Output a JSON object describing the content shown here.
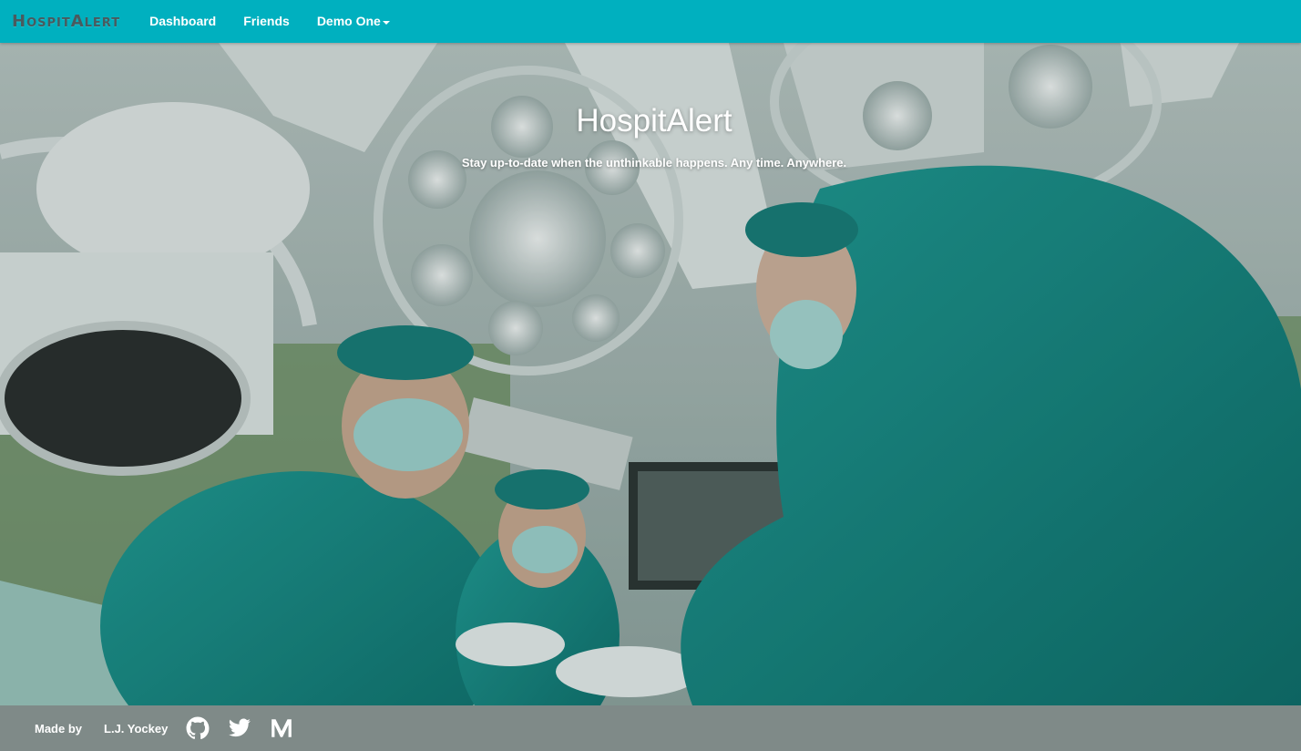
{
  "navbar": {
    "brand": "HospitAlert",
    "items": [
      {
        "label": "Dashboard"
      },
      {
        "label": "Friends"
      },
      {
        "label": "Demo One"
      }
    ],
    "color": "#00b0bf"
  },
  "hero": {
    "title": "HospitAlert",
    "subtitle": "Stay up-to-date when the unthinkable happens. Any time. Anywhere.",
    "background": "operating-room-photo"
  },
  "footer": {
    "made_by": "Made by",
    "author": "L.J. Yockey",
    "icons": [
      "github-icon",
      "twitter-icon",
      "medium-icon"
    ],
    "color": "#7f8a88"
  }
}
